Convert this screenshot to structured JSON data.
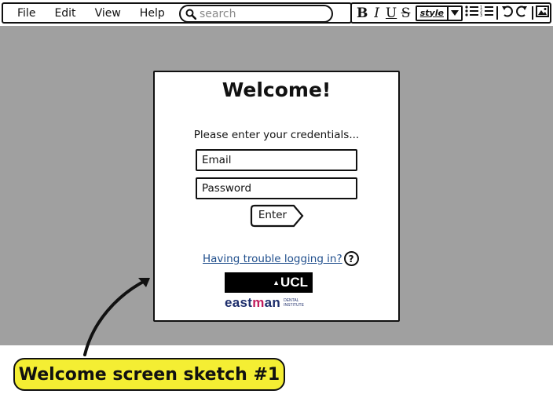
{
  "menubar": {
    "items": [
      {
        "label": "File"
      },
      {
        "label": "Edit"
      },
      {
        "label": "View"
      },
      {
        "label": "Help"
      }
    ],
    "search": {
      "placeholder": "search",
      "icon": "search-icon"
    }
  },
  "toolbar": {
    "bold": "B",
    "italic": "I",
    "underline": "U",
    "strike": "S",
    "style_value": "style",
    "icons": [
      "bold-icon",
      "italic-icon",
      "underline-icon",
      "strikethrough-icon",
      "style-dropdown",
      "bulleted-list-icon",
      "numbered-list-icon",
      "undo-icon",
      "redo-icon",
      "image-icon"
    ]
  },
  "dialog": {
    "title": "Welcome!",
    "subtitle": "Please enter your credentials...",
    "email_placeholder": "Email",
    "password_placeholder": "Password",
    "enter_label": "Enter",
    "help_link": "Having trouble logging in?",
    "help_icon": "?",
    "logos": {
      "ucl": "UCL",
      "eastman_prefix": "east",
      "eastman_m": "m",
      "eastman_suffix": "an",
      "eastman_sub_line1": "DENTAL",
      "eastman_sub_line2": "INSTITUTE"
    }
  },
  "caption": "Welcome screen sketch #1",
  "colors": {
    "canvas": "#a0a0a0",
    "caption_bg": "#f4ee33",
    "link": "#1f4e8c",
    "eastman_blue": "#1d2d6b",
    "eastman_pink": "#c21d5d"
  }
}
